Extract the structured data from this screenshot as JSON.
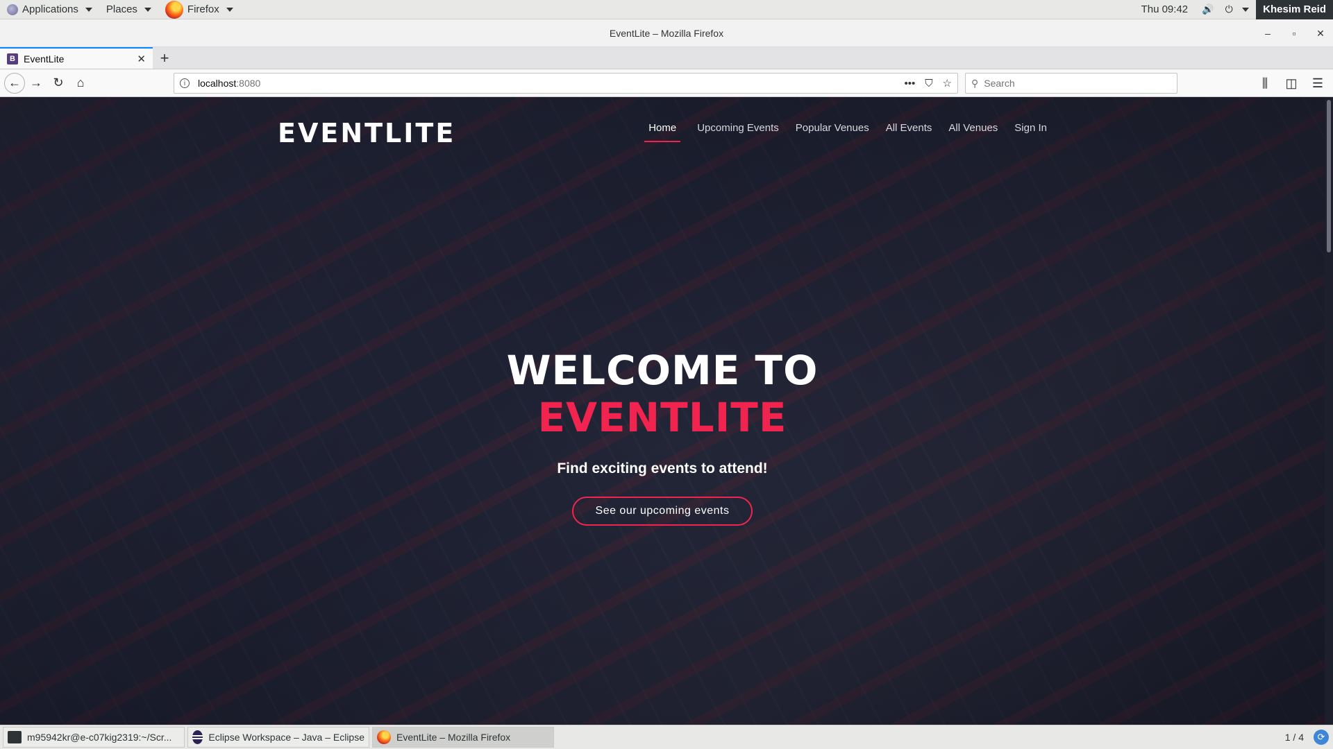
{
  "topbar": {
    "applications": "Applications",
    "places": "Places",
    "browser": "Firefox",
    "clock": "Thu 09:42",
    "user": "Khesim Reid"
  },
  "window": {
    "title": "EventLite – Mozilla Firefox"
  },
  "tabs": [
    {
      "label": "EventLite",
      "favicon": "B"
    }
  ],
  "navbar": {
    "url_host": "localhost",
    "url_port": ":8080",
    "search_placeholder": "Search"
  },
  "site": {
    "logo": "EVENTLITE",
    "nav": [
      {
        "label": "Home",
        "active": true
      },
      {
        "label": "Upcoming Events"
      },
      {
        "label": "Popular Venues"
      },
      {
        "label": "All Events"
      },
      {
        "label": "All Venues"
      },
      {
        "label": "Sign In"
      }
    ],
    "hero": {
      "line1": "WELCOME TO",
      "line2": "EVENTLITE",
      "subtitle": "Find exciting events to attend!",
      "button": "See our upcoming events"
    },
    "colors": {
      "accent": "#f0244f"
    }
  },
  "taskbar": {
    "tasks": [
      {
        "label": "m95942kr@e-c07kig2319:~/Scr..."
      },
      {
        "label": "Eclipse Workspace – Java – Eclipse"
      },
      {
        "label": "EventLite – Mozilla Firefox"
      }
    ],
    "workspace": "1 / 4"
  }
}
